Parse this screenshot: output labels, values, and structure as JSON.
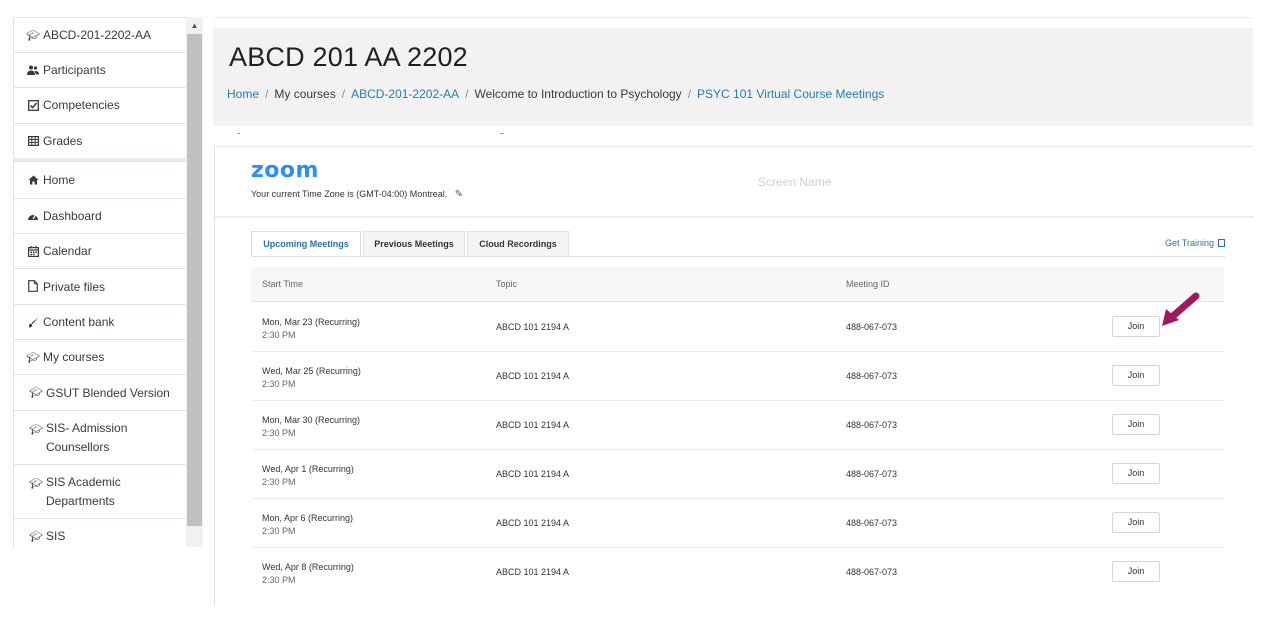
{
  "sidebar": {
    "items": [
      {
        "label": "ABCD-201-2202-AA",
        "icon": "graduation-cap-icon"
      },
      {
        "label": "Participants",
        "icon": "users-icon"
      },
      {
        "label": "Competencies",
        "icon": "check-square-icon"
      },
      {
        "label": "Grades",
        "icon": "table-icon"
      },
      {
        "label": "Home",
        "icon": "home-icon"
      },
      {
        "label": "Dashboard",
        "icon": "dashboard-icon"
      },
      {
        "label": "Calendar",
        "icon": "calendar-icon"
      },
      {
        "label": "Private files",
        "icon": "file-icon"
      },
      {
        "label": "Content bank",
        "icon": "paint-brush-icon"
      },
      {
        "label": "My courses",
        "icon": "graduation-cap-icon"
      },
      {
        "label": "GSUT Blended Version",
        "icon": "graduation-cap-icon"
      },
      {
        "label_line1": "SIS- Admission",
        "label_line2": "Counsellors",
        "icon": "graduation-cap-icon"
      },
      {
        "label_line1": "SIS Academic",
        "label_line2": "Departments",
        "icon": "graduation-cap-icon"
      },
      {
        "label": "SIS",
        "icon": "graduation-cap-icon"
      }
    ]
  },
  "header": {
    "title": "ABCD 201 AA 2202",
    "breadcrumb": [
      {
        "label": "Home",
        "link": true
      },
      {
        "label": "My courses",
        "link": false
      },
      {
        "label": "ABCD-201-2202-AA",
        "link": true
      },
      {
        "label": "Welcome to Introduction to Psychology",
        "link": false
      },
      {
        "label": "PSYC 101 Virtual Course Meetings",
        "link": true
      }
    ]
  },
  "zoom": {
    "logo": "zoom",
    "timezone": "Your current Time Zone is (GMT-04:00) Montreal.",
    "screen_name": "Screen Name",
    "tabs": [
      "Upcoming Meetings",
      "Previous Meetings",
      "Cloud Recordings"
    ],
    "active_tab": "Upcoming Meetings",
    "get_training": "Get Training",
    "columns": [
      "Start Time",
      "Topic",
      "Meeting ID"
    ],
    "join_label": "Join",
    "meetings": [
      {
        "date": "Mon, Mar 23 (Recurring)",
        "time": "2:30 PM",
        "topic": "ABCD 101 2194 A",
        "meeting_id": "488-067-073"
      },
      {
        "date": "Wed, Mar 25 (Recurring)",
        "time": "2:30 PM",
        "topic": "ABCD 101 2194 A",
        "meeting_id": "488-067-073"
      },
      {
        "date": "Mon, Mar 30 (Recurring)",
        "time": "2:30 PM",
        "topic": "ABCD 101 2194 A",
        "meeting_id": "488-067-073"
      },
      {
        "date": "Wed, Apr 1 (Recurring)",
        "time": "2:30 PM",
        "topic": "ABCD 101 2194 A",
        "meeting_id": "488-067-073"
      },
      {
        "date": "Mon, Apr 6 (Recurring)",
        "time": "2:30 PM",
        "topic": "ABCD 101 2194 A",
        "meeting_id": "488-067-073"
      },
      {
        "date": "Wed, Apr 8 (Recurring)",
        "time": "2:30 PM",
        "topic": "ABCD 101 2194 A",
        "meeting_id": "488-067-073"
      }
    ]
  },
  "colors": {
    "link": "#2a7ab0",
    "zoom_brand": "#2d8cff",
    "arrow_annotation": "#a0195e",
    "header_bg": "#f2f2f2"
  }
}
